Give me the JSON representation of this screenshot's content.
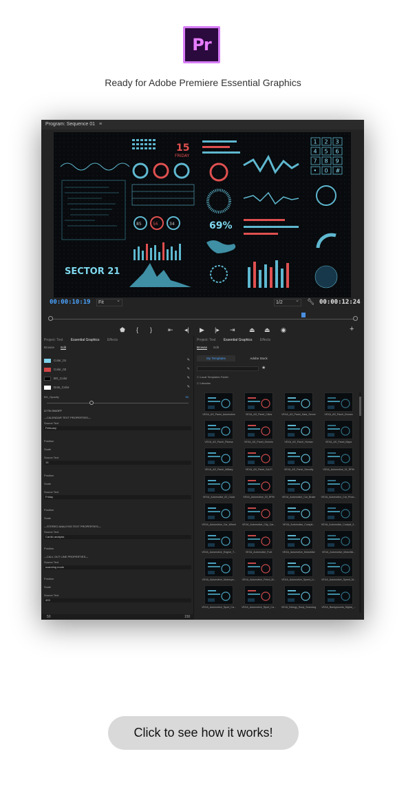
{
  "header": {
    "logo_text": "Pr",
    "tagline": "Ready for Adobe Premiere Essential Graphics"
  },
  "monitor": {
    "title": "Program: Sequence 01",
    "menu_icon": "hamburger-icon",
    "viewer_labels": {
      "date_number": "15",
      "date_day": "FRIDAY",
      "gauge_percent": "69%",
      "sector": "SECTOR 21",
      "keypad": [
        "1",
        "2",
        "3",
        "4",
        "5",
        "6",
        "7",
        "8",
        "9",
        "•",
        "0",
        "#"
      ],
      "ring_values": [
        "85",
        "56",
        "34"
      ]
    },
    "timecode_current": "00:00:10:19",
    "zoom": "Fit",
    "resolution": "1/2",
    "timecode_duration": "00:00:12:24"
  },
  "transport_icons": [
    "marker-icon",
    "in-point-icon",
    "out-point-icon",
    "go-to-in-icon",
    "step-back-icon",
    "play-icon",
    "step-forward-icon",
    "go-to-out-icon",
    "lift-icon",
    "extract-icon",
    "export-frame-icon",
    "add-icon"
  ],
  "left_panel": {
    "tabs": [
      "Project: Text",
      "Essential Graphics",
      "Effects"
    ],
    "subtabs": [
      "Browse",
      "Edit"
    ],
    "colors": [
      {
        "label": "Color_01",
        "hex": "#7fd0e8"
      },
      {
        "label": "Color_02",
        "hex": "#d04545"
      },
      {
        "label": "BG_Color",
        "hex": "#000000"
      },
      {
        "label": "Dots_Color",
        "hex": "#ffffff"
      }
    ],
    "bg_opacity_label": "BG_Opacity",
    "bg_opacity_value": "50",
    "show_grid": "TB ON/OFF",
    "sections": [
      "—CALENDAR TEXT PROPERTIES—",
      "—STEREO ANALYSIS TEXT PROPERTIES—",
      "—CALL OUT LINE PROPERTIES—"
    ],
    "source_text_label": "Source Text",
    "position_label": "Position",
    "scale_label": "Scale",
    "fields": [
      "February",
      "15",
      "Friday",
      "Cardio analysis",
      "scanning mode",
      "403"
    ],
    "bottom_left": "50",
    "bottom_mid": "150"
  },
  "right_panel": {
    "tabs": [
      "Project: Text",
      "Essential Graphics",
      "Effects"
    ],
    "subtabs": [
      "Browse",
      "Edit"
    ],
    "my_templates": "My Templates",
    "adobe_stock": "Adobe Stock",
    "local_folder": "Local Templates Folder",
    "libraries": "Libraries",
    "templates": [
      "VEXA_AS_Panel_Automotive",
      "VEXA_AS_Panel_Cities",
      "VEXA_AS_Panel_Data_Server",
      "VEXA_AS_Panel_Drones",
      "VEXA_AS_Panel_Fitness",
      "VEXA_AS_Panel_Generic",
      "VEXA_AS_Panel_Human",
      "VEXA_AS_Panel_Maps",
      "VEXA_AS_Panel_Military",
      "VEXA_AS_Panel_Sci-Fi",
      "VEXA_AS_Panel_Security",
      "VEXA_Automotive_01_RPM",
      "VEXA_Automotive_02_Clock",
      "VEXA_Automotive_03_RPM",
      "VEXA_Automotive_Car_Brake",
      "VEXA_Automotive_Car_Proto...",
      "VEXA_Automotive_Car_Wheel",
      "VEXA_Automotive_City_Car...",
      "VEXA_Automotive_Cockpit...",
      "VEXA_Automotive_Cockpit_2...",
      "VEXA_Automotive_Engine_T...",
      "VEXA_Automotive_Fuel",
      "VEXA_Automotive_Motorbike",
      "VEXA_Automotive_Motorbik...",
      "VEXA_Automotive_Motorcyc...",
      "VEXA_Automotive_Petrol_M...",
      "VEXA_Automotive_Speed_Li...",
      "VEXA_Automotive_Speed_M...",
      "VEXA_Automotive_Sport_Ca...",
      "VEXA_Automotive_Sport_Ca...",
      "VEXA_Biology_Body_Scanning",
      "VEXA_Backgrounds_Digital_..."
    ]
  },
  "cta": "Click to see how it works!"
}
